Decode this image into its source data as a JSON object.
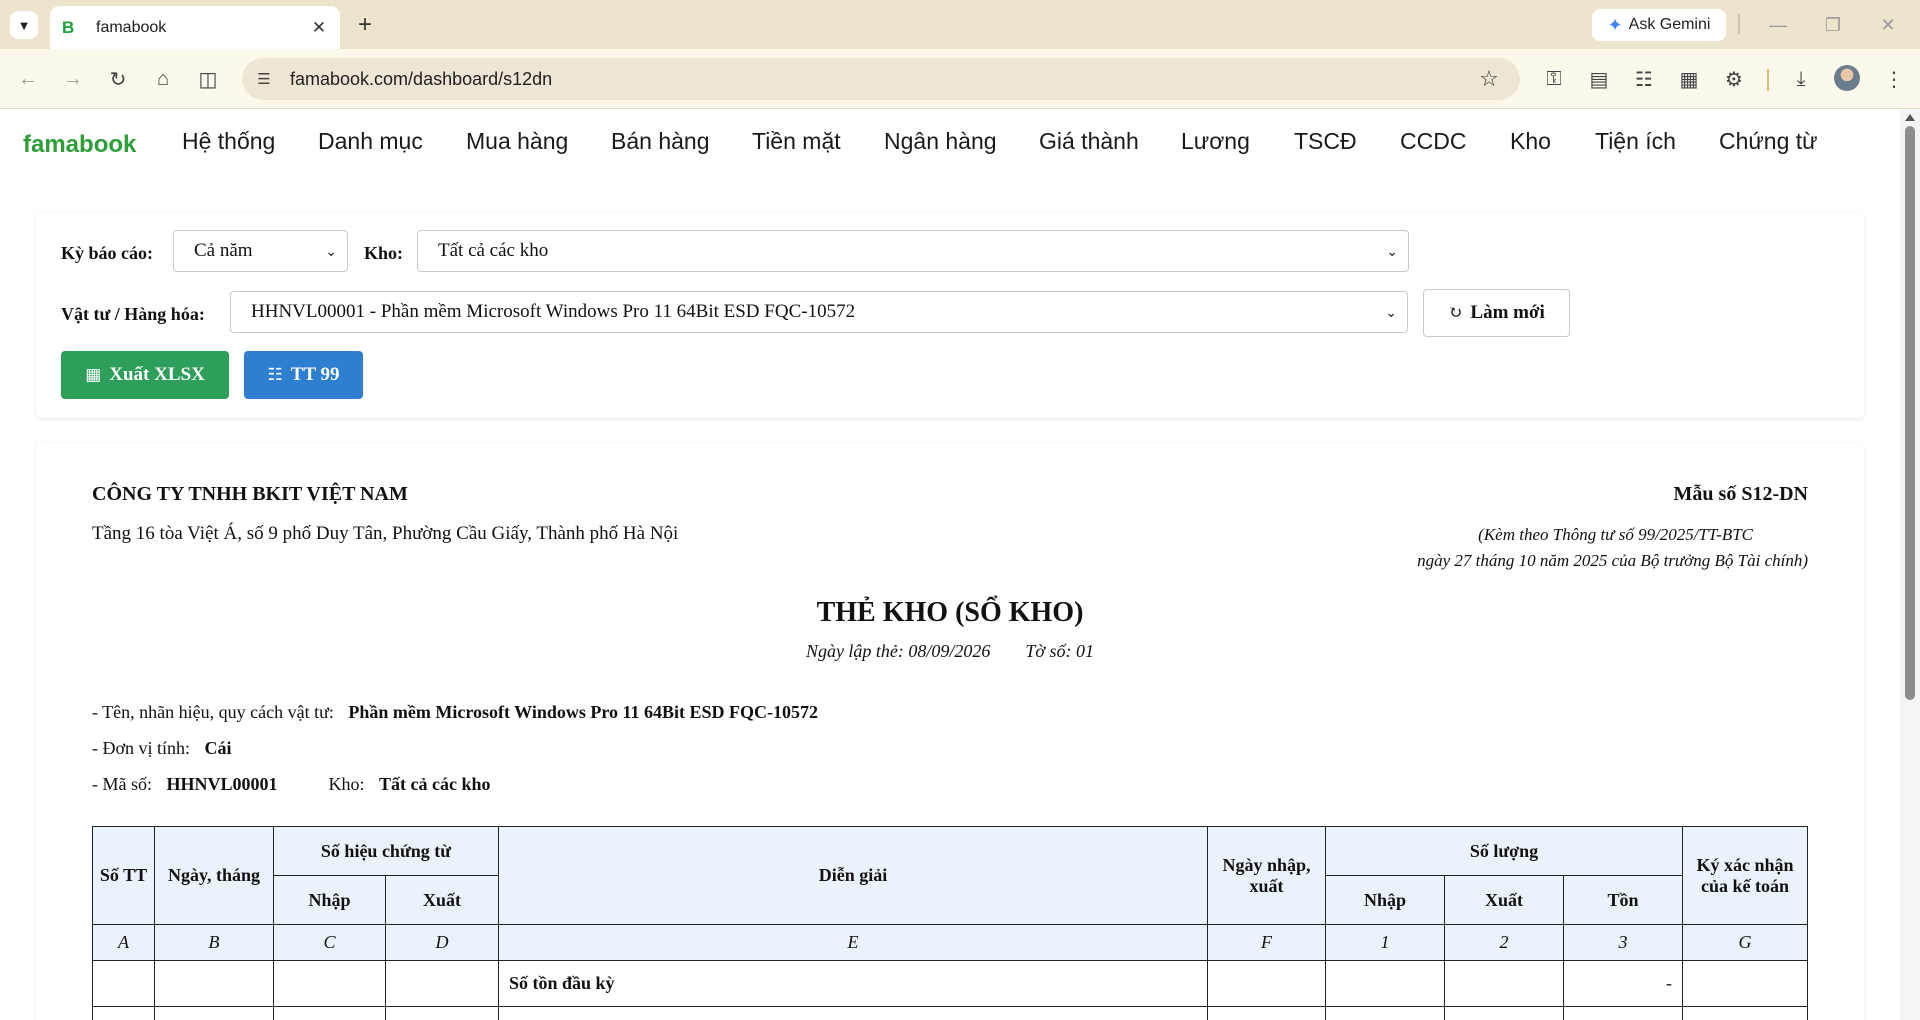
{
  "browser": {
    "tab_title": "famabook",
    "tab_favicon": "B",
    "url": "famabook.com/dashboard/s12dn",
    "ask_gemini": "Ask Gemini"
  },
  "nav": {
    "brand": "famabook",
    "items": [
      "Hệ thống",
      "Danh mục",
      "Mua hàng",
      "Bán hàng",
      "Tiền mặt",
      "Ngân hàng",
      "Giá thành",
      "Lương",
      "TSCĐ",
      "CCDC",
      "Kho",
      "Tiện ích",
      "Chứng từ"
    ]
  },
  "filters": {
    "period_label": "Kỳ báo cáo:",
    "period_value": "Cả năm",
    "warehouse_label": "Kho:",
    "warehouse_value": "Tất cả các kho",
    "item_label": "Vật tư / Hàng hóa:",
    "item_value": "HHNVL00001 - Phần mềm Microsoft Windows Pro 11 64Bit ESD FQC-10572",
    "refresh_label": "Làm mới",
    "export_label": "Xuất XLSX",
    "tt99_label": "TT 99"
  },
  "report": {
    "company": "CÔNG TY TNHH BKIT VIỆT NAM",
    "address": "Tầng 16 tòa Việt Á, số 9 phố Duy Tân, Phường Cầu Giấy, Thành phố Hà Nội",
    "form_no": "Mẫu số S12-DN",
    "form_note1": "(Kèm theo Thông tư số 99/2025/TT-BTC",
    "form_note2": "ngày 27 tháng 10 năm 2025 của Bộ trưởng Bộ Tài chính)",
    "title": "THẺ KHO (SỔ KHO)",
    "date_label": "Ngày lập thẻ: 08/09/2026",
    "sheet_label": "Tờ số: 01",
    "item_name_label": "- Tên, nhãn hiệu, quy cách vật tư:",
    "item_name": "Phần mềm Microsoft Windows Pro 11 64Bit ESD FQC-10572",
    "unit_label": "- Đơn vị tính:",
    "unit": "Cái",
    "code_label": "- Mã số:",
    "code": "HHNVL00001",
    "wh_label": "Kho:",
    "wh": "Tất cả các kho",
    "table": {
      "h_stt": "Số TT",
      "h_date": "Ngày, tháng",
      "h_doc": "Số hiệu chứng từ",
      "h_doc_in": "Nhập",
      "h_doc_out": "Xuất",
      "h_desc": "Diễn giải",
      "h_io_date": "Ngày nhập, xuất",
      "h_qty": "Số lượng",
      "h_qty_in": "Nhập",
      "h_qty_out": "Xuất",
      "h_qty_bal": "Tồn",
      "h_sign": "Ký xác nhận của kế toán",
      "codes": [
        "A",
        "B",
        "C",
        "D",
        "E",
        "F",
        "1",
        "2",
        "3",
        "G"
      ],
      "opening_label": "Số tồn đầu kỳ",
      "opening_balance": "-"
    }
  },
  "colors": {
    "brand": "#2e9e3a",
    "export_button": "#2e9e5b",
    "tt99_button": "#2f7fd0",
    "table_header_bg": "#eaf3fb"
  },
  "icons": {
    "tab_menu": "chevron-down-icon",
    "back": "arrow-left-icon",
    "forward": "arrow-right-icon",
    "reload": "reload-icon",
    "home": "home-icon",
    "split": "split-view-icon",
    "star": "star-icon",
    "refresh_button": "refresh-icon",
    "export_button": "excel-file-icon",
    "tt99_button": "book-icon"
  }
}
